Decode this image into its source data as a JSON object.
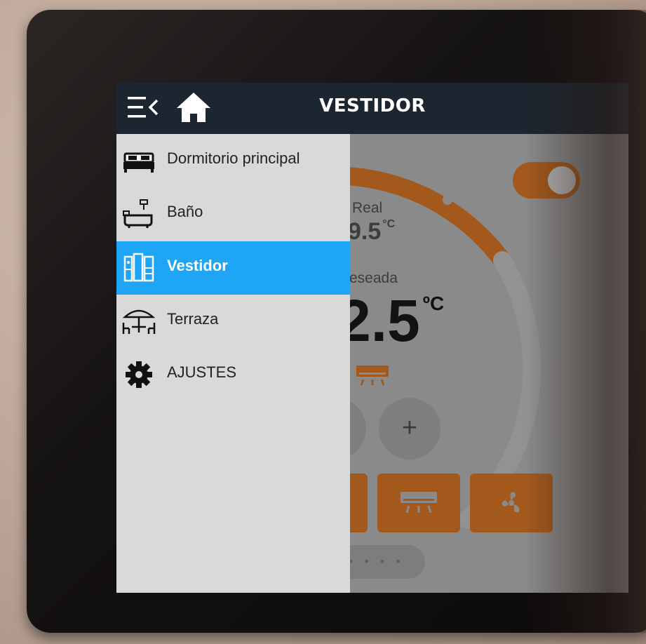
{
  "header": {
    "title": "VESTIDOR",
    "menu_icon": "menu-collapse-icon",
    "home_icon": "home-icon",
    "bar_color": "#1c2630"
  },
  "drawer": {
    "items": [
      {
        "label": "Dormitorio principal",
        "icon": "bed-icon",
        "active": false
      },
      {
        "label": "Baño",
        "icon": "bathtub-icon",
        "active": false
      },
      {
        "label": "Vestidor",
        "icon": "wardrobe-icon",
        "active": true
      },
      {
        "label": "Terraza",
        "icon": "terrace-icon",
        "active": false
      },
      {
        "label": "AJUSTES",
        "icon": "gear-icon",
        "active": false
      }
    ],
    "active_color": "#1ea5f5",
    "background": "#d9d9d9"
  },
  "thermostat": {
    "real_label": "Real",
    "real_value": "9.5",
    "real_unit": "°C",
    "desired_label": "eseada",
    "desired_value": "2.5",
    "desired_unit": "ºC",
    "plus_label": "+",
    "accent_color": "#a3591c"
  },
  "pager": {
    "dots": "• • • •"
  }
}
